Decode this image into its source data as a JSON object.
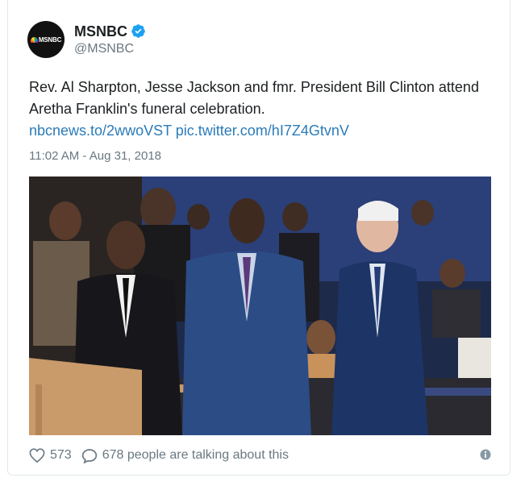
{
  "account": {
    "display_name": "MSNBC",
    "handle": "@MSNBC",
    "avatar_text": "MSNBC",
    "verified_icon": "verified-badge-icon"
  },
  "tweet": {
    "text": "Rev. Al Sharpton, Jesse Jackson and fmr. President Bill Clinton attend Aretha Franklin's funeral celebration.",
    "link_1": "nbcnews.to/2wwoVST",
    "link_2": "pic.twitter.com/hI7Z4GtvnV",
    "timestamp": "11:02 AM - Aug 31, 2018"
  },
  "footer": {
    "like_count": "573",
    "talking_text": "678 people are talking about this",
    "like_icon": "heart-icon",
    "reply_icon": "speech-bubble-icon",
    "info_icon": "info-icon"
  },
  "colors": {
    "link": "#2b7bb9",
    "muted": "#697882",
    "text": "#1c2022",
    "verified": "#1da1f2"
  }
}
